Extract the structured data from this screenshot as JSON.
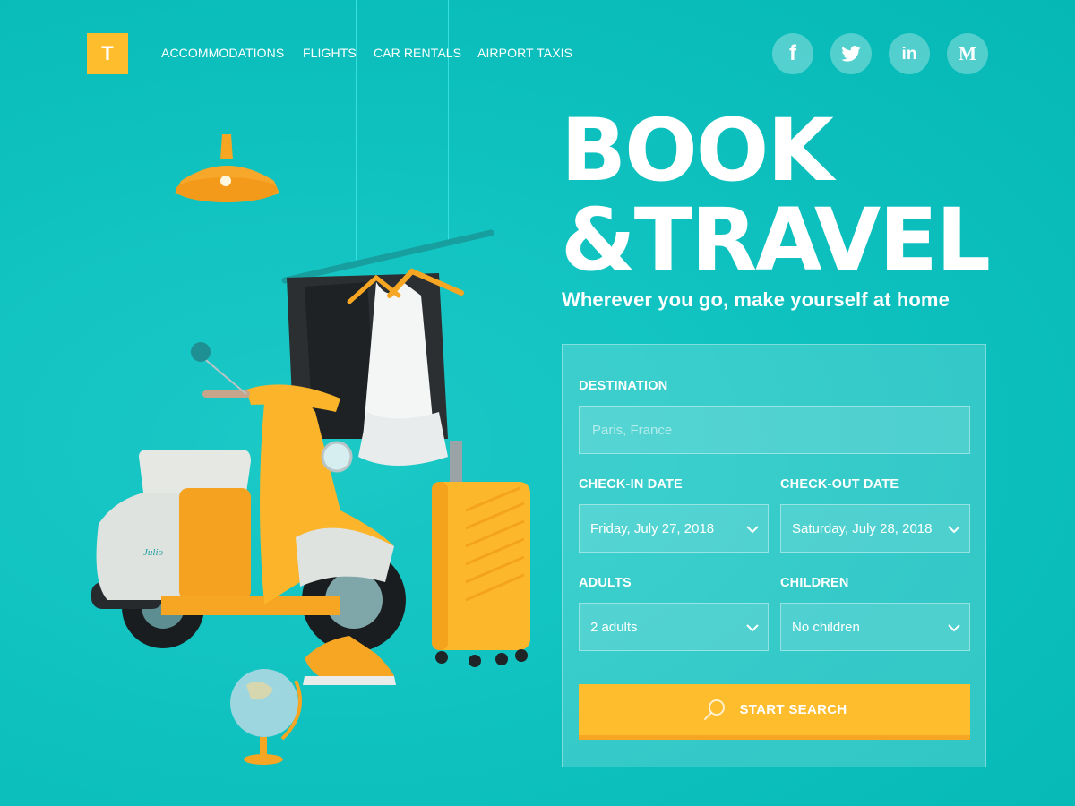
{
  "header": {
    "logo_letter": "T",
    "nav": [
      {
        "label": "ACCOMMODATIONS"
      },
      {
        "label": "FLIGHTS"
      },
      {
        "label": "CAR RENTALS"
      },
      {
        "label": "AIRPORT TAXIS"
      }
    ],
    "social": [
      {
        "name": "facebook-icon",
        "glyph": "f"
      },
      {
        "name": "twitter-icon",
        "glyph": "🐦"
      },
      {
        "name": "linkedin-icon",
        "glyph": "in"
      },
      {
        "name": "medium-icon",
        "glyph": "M"
      }
    ]
  },
  "hero": {
    "title_line1": "BOOK",
    "title_line2": "&TRAVEL",
    "subtitle": "Wherever you go, make yourself at home"
  },
  "form": {
    "destination": {
      "label": "DESTINATION",
      "placeholder": "Paris, France",
      "value": ""
    },
    "checkin": {
      "label": "CHECK-IN DATE",
      "value": "Friday, July 27, 2018"
    },
    "checkout": {
      "label": "CHECK-OUT DATE",
      "value": "Saturday, July 28, 2018"
    },
    "adults": {
      "label": "ADULTS",
      "value": "2 adults"
    },
    "children": {
      "label": "CHILDREN",
      "value": "No children"
    },
    "submit_label": "START SEARCH"
  },
  "illustration": {
    "scooter_brand": "Julio"
  },
  "colors": {
    "background": "#0fc2c0",
    "accent": "#fdbd2c",
    "accent_dark": "#f6a623",
    "text": "#ffffff"
  }
}
